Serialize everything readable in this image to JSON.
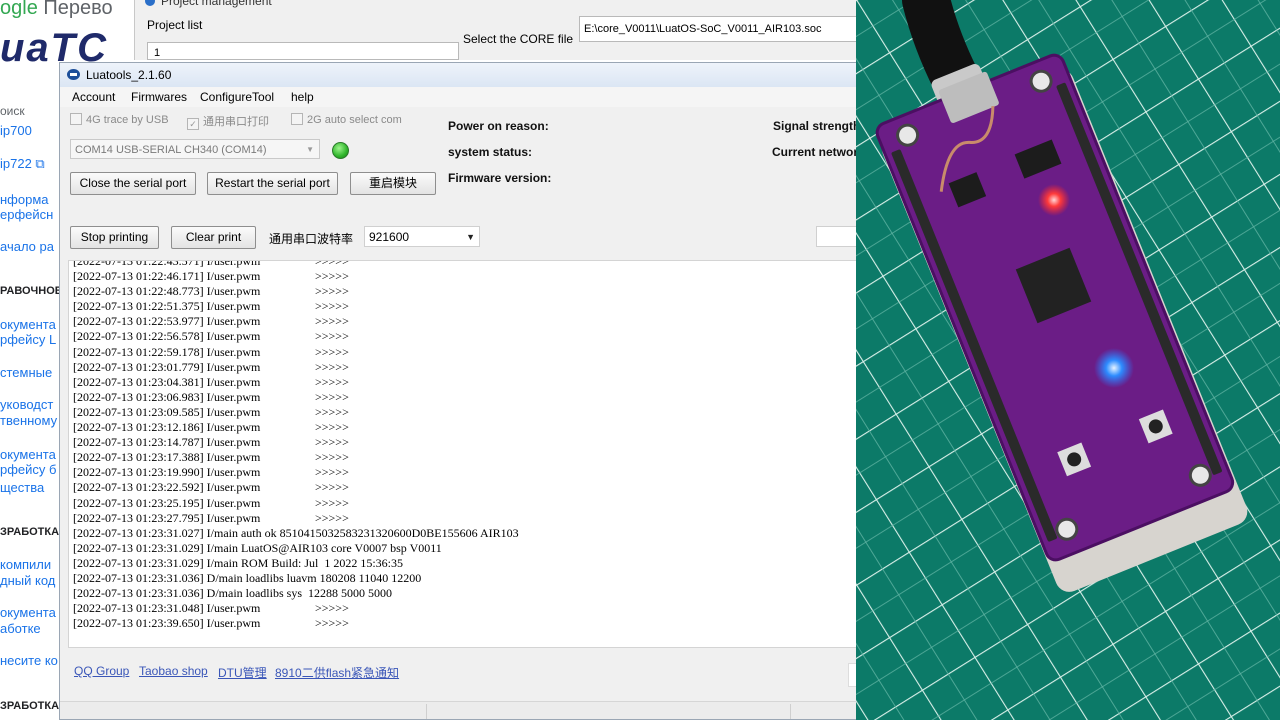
{
  "background_page": {
    "logo_text_google": "ogle",
    "logo_text_translate": " Перево",
    "brand_text": "uaTC",
    "sidebar": [
      {
        "type": "plain",
        "text": "оиск"
      },
      {
        "type": "link",
        "text": "ip700"
      },
      {
        "type": "link",
        "text": "ip722 ⧉"
      },
      {
        "type": "link",
        "text": "нформа"
      },
      {
        "type": "link",
        "text": "ерфейсн"
      },
      {
        "type": "link",
        "text": "ачало ра"
      },
      {
        "type": "head",
        "text": "РАВОЧНОЕ"
      },
      {
        "type": "link",
        "text": "окумента"
      },
      {
        "type": "link",
        "text": "рфейсу L"
      },
      {
        "type": "link",
        "text": "стемные"
      },
      {
        "type": "link",
        "text": "уководст"
      },
      {
        "type": "link",
        "text": "твенному"
      },
      {
        "type": "link",
        "text": "окумента"
      },
      {
        "type": "link",
        "text": "рфейсу б"
      },
      {
        "type": "link",
        "text": "щества"
      },
      {
        "type": "head",
        "text": "ЗРАБОТКА"
      },
      {
        "type": "link",
        "text": "компили"
      },
      {
        "type": "link",
        "text": "дный код"
      },
      {
        "type": "link",
        "text": "окумента"
      },
      {
        "type": "link",
        "text": "аботке"
      },
      {
        "type": "link",
        "text": "несите ко"
      },
      {
        "type": "head",
        "text": "ЗРАБОТКА"
      }
    ]
  },
  "project_window": {
    "title": "Project management",
    "project_list_label": "Project list",
    "project_list_value": "1",
    "core_file_label": "Select the CORE file",
    "core_file_value": "E:\\core_V0011\\LuatOS-SoC_V0011_AIR103.soc"
  },
  "luatools": {
    "title": "Luatools_2.1.60",
    "menu": [
      "Account",
      "Firmwares",
      "ConfigureTool",
      "help"
    ],
    "checkboxes": [
      {
        "label": "4G trace by USB",
        "checked": false
      },
      {
        "label": "通用串口打印",
        "checked": true
      },
      {
        "label": "2G auto select com",
        "checked": false
      }
    ],
    "com_port": "COM14 USB-SERIAL CH340 (COM14)",
    "buttons": {
      "close_serial": "Close the serial port",
      "restart_serial": "Restart the serial port",
      "restart_module": "重启模块",
      "stop_printing": "Stop printing",
      "clear_print": "Clear print"
    },
    "info": {
      "power_on_reason": "Power on reason:",
      "system_status": "system status:",
      "firmware_version": "Firmware version:",
      "signal_strength": "Signal strength",
      "current_network": "Current networ"
    },
    "baud_label": "通用串口波特率",
    "baud_value": "921600",
    "log_lines": [
      {
        "ts": "[2022-07-13 01:22:43.571]",
        "msg": " I/user.pwm",
        "arrows": ">>>>>"
      },
      {
        "ts": "[2022-07-13 01:22:46.171]",
        "msg": " I/user.pwm",
        "arrows": ">>>>>"
      },
      {
        "ts": "[2022-07-13 01:22:48.773]",
        "msg": " I/user.pwm",
        "arrows": ">>>>>"
      },
      {
        "ts": "[2022-07-13 01:22:51.375]",
        "msg": " I/user.pwm",
        "arrows": ">>>>>"
      },
      {
        "ts": "[2022-07-13 01:22:53.977]",
        "msg": " I/user.pwm",
        "arrows": ">>>>>"
      },
      {
        "ts": "[2022-07-13 01:22:56.578]",
        "msg": " I/user.pwm",
        "arrows": ">>>>>"
      },
      {
        "ts": "[2022-07-13 01:22:59.178]",
        "msg": " I/user.pwm",
        "arrows": ">>>>>"
      },
      {
        "ts": "[2022-07-13 01:23:01.779]",
        "msg": " I/user.pwm",
        "arrows": ">>>>>"
      },
      {
        "ts": "[2022-07-13 01:23:04.381]",
        "msg": " I/user.pwm",
        "arrows": ">>>>>"
      },
      {
        "ts": "[2022-07-13 01:23:06.983]",
        "msg": " I/user.pwm",
        "arrows": ">>>>>"
      },
      {
        "ts": "[2022-07-13 01:23:09.585]",
        "msg": " I/user.pwm",
        "arrows": ">>>>>"
      },
      {
        "ts": "[2022-07-13 01:23:12.186]",
        "msg": " I/user.pwm",
        "arrows": ">>>>>"
      },
      {
        "ts": "[2022-07-13 01:23:14.787]",
        "msg": " I/user.pwm",
        "arrows": ">>>>>"
      },
      {
        "ts": "[2022-07-13 01:23:17.388]",
        "msg": " I/user.pwm",
        "arrows": ">>>>>"
      },
      {
        "ts": "[2022-07-13 01:23:19.990]",
        "msg": " I/user.pwm",
        "arrows": ">>>>>"
      },
      {
        "ts": "[2022-07-13 01:23:22.592]",
        "msg": " I/user.pwm",
        "arrows": ">>>>>"
      },
      {
        "ts": "[2022-07-13 01:23:25.195]",
        "msg": " I/user.pwm",
        "arrows": ">>>>>"
      },
      {
        "ts": "[2022-07-13 01:23:27.795]",
        "msg": " I/user.pwm",
        "arrows": ">>>>>"
      },
      {
        "ts": "[2022-07-13 01:23:31.027]",
        "msg": " I/main auth ok 8510415032583231320600D0BE155606 AIR103",
        "arrows": ""
      },
      {
        "ts": "[2022-07-13 01:23:31.029]",
        "msg": " I/main LuatOS@AIR103 core V0007 bsp V0011",
        "arrows": ""
      },
      {
        "ts": "[2022-07-13 01:23:31.029]",
        "msg": " I/main ROM Build: Jul  1 2022 15:36:35",
        "arrows": ""
      },
      {
        "ts": "[2022-07-13 01:23:31.036]",
        "msg": " D/main loadlibs luavm 180208 11040 12200",
        "arrows": ""
      },
      {
        "ts": "[2022-07-13 01:23:31.036]",
        "msg": " D/main loadlibs sys  12288 5000 5000",
        "arrows": ""
      },
      {
        "ts": "[2022-07-13 01:23:31.048]",
        "msg": " I/user.pwm",
        "arrows": ">>>>>"
      },
      {
        "ts": "[2022-07-13 01:23:39.650]",
        "msg": " I/user.pwm",
        "arrows": ">>>>>"
      }
    ],
    "links": [
      "QQ Group",
      "Taobao shop",
      "DTU管理",
      "8910二供flash紧急通知"
    ],
    "led_color": "#2fb52b"
  }
}
